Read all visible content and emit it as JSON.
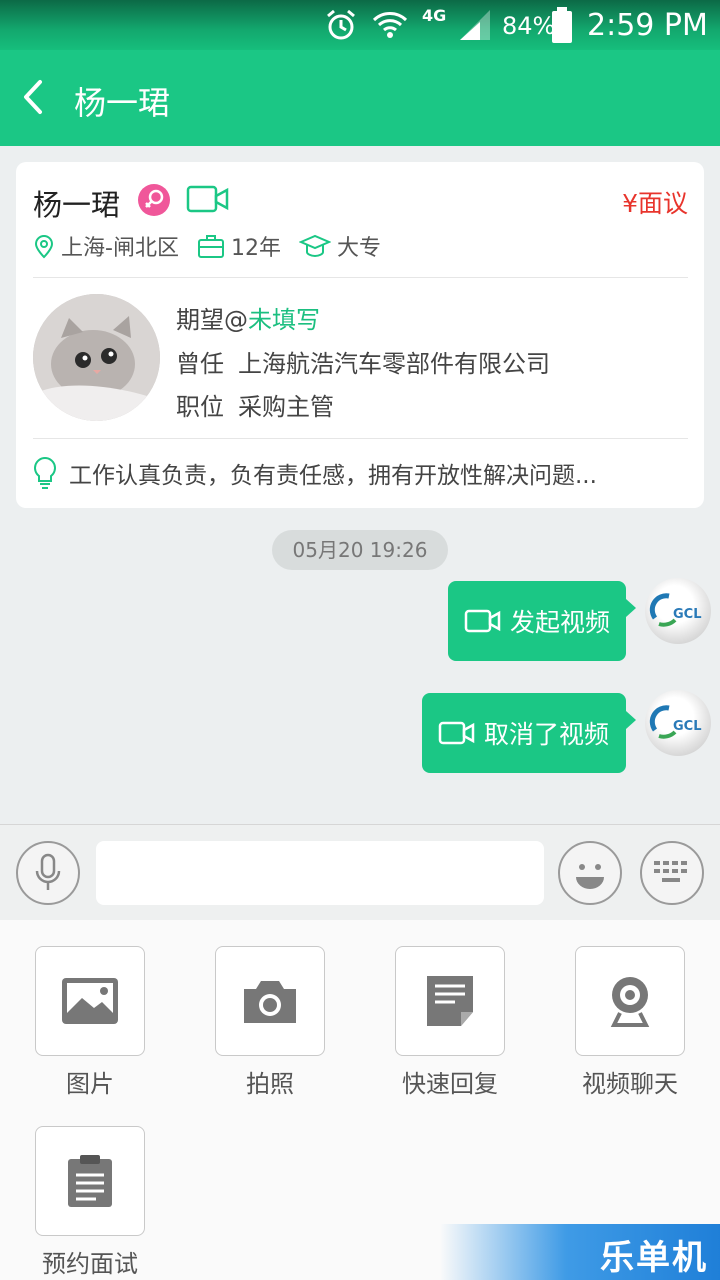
{
  "status_bar": {
    "network": "4G",
    "battery": "84%",
    "time": "2:59 PM"
  },
  "header": {
    "title": "杨一珺"
  },
  "resume_card": {
    "name": "杨一珺",
    "salary": "¥面议",
    "location": "上海-闸北区",
    "experience": "12年",
    "education": "大专",
    "expect_label": "期望@",
    "expect_value": "未填写",
    "previous_company_label": "曾任",
    "previous_company": "上海航浩汽车零部件有限公司",
    "position_label": "职位",
    "position": "采购主管",
    "summary": "工作认真负责，负有责任感，拥有开放性解决问题..."
  },
  "chat": {
    "timestamp": "05月20 19:26",
    "messages": [
      {
        "text": "发起视频",
        "icon": "video-icon"
      },
      {
        "text": "取消了视频",
        "icon": "video-icon"
      }
    ],
    "avatar_text": "GCL"
  },
  "input": {
    "placeholder": ""
  },
  "tools": [
    {
      "label": "图片",
      "icon": "image-icon"
    },
    {
      "label": "拍照",
      "icon": "camera-icon"
    },
    {
      "label": "快速回复",
      "icon": "quick-reply-icon"
    },
    {
      "label": "视频聊天",
      "icon": "webcam-icon"
    },
    {
      "label": "预约面试",
      "icon": "clipboard-icon"
    }
  ],
  "watermark": "乐单机",
  "colors": {
    "brand": "#1bc785",
    "salary": "#e8342c",
    "accent": "#1bbf80"
  }
}
